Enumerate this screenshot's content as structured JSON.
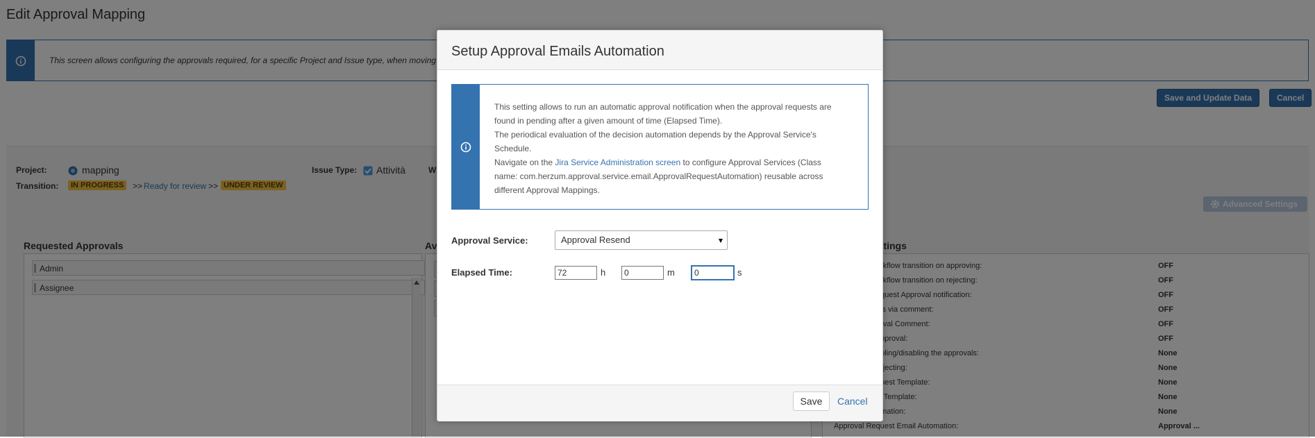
{
  "page": {
    "title": "Edit Approval Mapping",
    "info_text": "This screen allows configuring the approvals required, for a specific Project and Issue type, when moving",
    "save_update_label": "Save and Update Data",
    "cancel_label": "Cancel"
  },
  "mapping": {
    "project_label": "Project:",
    "project_value": "mapping",
    "issue_type_label": "Issue Type:",
    "issue_type_value": "Attività",
    "w_label": "W",
    "transition_label": "Transition:",
    "transition_from": "IN PROGRESS",
    "transition_sep1": ">>",
    "transition_via": "Ready for review",
    "transition_sep2": ">>",
    "transition_to": "UNDER REVIEW",
    "advanced_settings_label": "Advanced Settings"
  },
  "requested_approvals": {
    "title": "Requested Approvals",
    "items": [
      "Admin",
      "Assignee"
    ]
  },
  "available_approvals": {
    "title": "Av"
  },
  "settings": {
    "title": "ettings",
    "rows": [
      {
        "label": "orkflow transition on approving:",
        "value": "OFF"
      },
      {
        "label": "orkflow transition on rejecting:",
        "value": "OFF"
      },
      {
        "label": "equest Approval notification:",
        "value": "OFF"
      },
      {
        "label": "als via comment:",
        "value": "OFF"
      },
      {
        "label": "roval Comment:",
        "value": "OFF"
      },
      {
        "label": "approval:",
        "value": "OFF"
      },
      {
        "label": "abling/disabling the approvals:",
        "value": "None"
      },
      {
        "label": "rejecting:",
        "value": "None"
      },
      {
        "label": "quest Template:",
        "value": "None"
      },
      {
        "label": "ly Template:",
        "value": "None"
      },
      {
        "label": "omation:",
        "value": "None"
      },
      {
        "label": "Approval Request Email Automation:",
        "value": "Approval ..."
      }
    ]
  },
  "dialog": {
    "title": "Setup Approval Emails Automation",
    "info_line1": "This setting allows to run an automatic approval notification when the approval requests are found in pending after a given amount of time (Elapsed Time).",
    "info_line2": "The periodical evaluation of the decision automation depends by the Approval Service's Schedule.",
    "info_line3_pre": "Navigate on the ",
    "info_link": "Jira Service Administration screen",
    "info_line3_post": " to configure Approval Services (Class name: com.herzum.approval.service.email.ApprovalRequestAutomation) reusable across different Approval Mappings.",
    "service_label": "Approval Service:",
    "service_value": "Approval Resend",
    "elapsed_label": "Elapsed Time:",
    "hours_value": "72",
    "hours_unit": "h",
    "minutes_value": "0",
    "minutes_unit": "m",
    "seconds_value": "0",
    "seconds_unit": "s",
    "save_label": "Save",
    "cancel_label": "Cancel"
  },
  "colors": {
    "primary": "#3572b0",
    "lozenge": "#f6c342"
  }
}
